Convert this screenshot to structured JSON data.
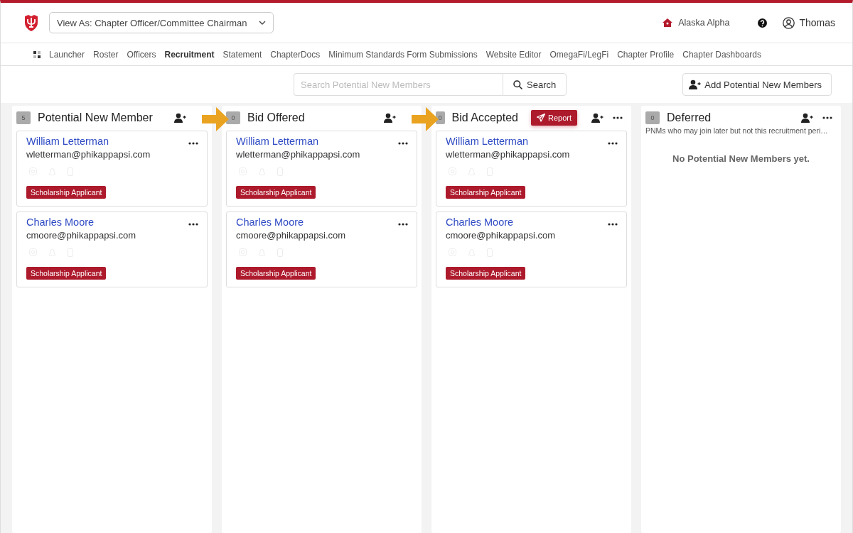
{
  "header": {
    "view_as": "View As: Chapter Officer/Committee Chairman",
    "chapter": "Alaska Alpha",
    "user": "Thomas"
  },
  "nav": [
    {
      "label": "Launcher",
      "selected": false
    },
    {
      "label": "Roster",
      "selected": false
    },
    {
      "label": "Officers",
      "selected": false
    },
    {
      "label": "Recruitment",
      "selected": true
    },
    {
      "label": "Statement",
      "selected": false
    },
    {
      "label": "ChapterDocs",
      "selected": false
    },
    {
      "label": "Minimum Standards Form Submissions",
      "selected": false
    },
    {
      "label": "Website Editor",
      "selected": false
    },
    {
      "label": "OmegaFi/LegFi",
      "selected": false
    },
    {
      "label": "Chapter Profile",
      "selected": false
    },
    {
      "label": "Chapter Dashboards",
      "selected": false
    }
  ],
  "search": {
    "placeholder": "Search Potential New Members",
    "button": "Search"
  },
  "add_button": "Add Potential New Members",
  "columns": [
    {
      "count": "5",
      "title": "Potential New Member",
      "more_menu": false,
      "arrow_after": true,
      "cards": [
        {
          "name": "William Letterman",
          "email": "wletterman@phikappapsi.com",
          "tags": [
            "Scholarship Applicant"
          ]
        },
        {
          "name": "Charles Moore",
          "email": "cmoore@phikappapsi.com",
          "tags": [
            "Scholarship Applicant"
          ]
        }
      ]
    },
    {
      "count": "0",
      "title": "Bid Offered",
      "more_menu": false,
      "arrow_after": true,
      "cards": [
        {
          "name": "William Letterman",
          "email": "wletterman@phikappapsi.com",
          "tags": [
            "Scholarship Applicant"
          ]
        },
        {
          "name": "Charles Moore",
          "email": "cmoore@phikappapsi.com",
          "tags": [
            "Scholarship Applicant"
          ]
        }
      ]
    },
    {
      "count": "0",
      "title": "Bid Accepted",
      "report_button": "Report",
      "more_menu": true,
      "arrow_after": false,
      "cards": [
        {
          "name": "William Letterman",
          "email": "wletterman@phikappapsi.com",
          "tags": [
            "Scholarship Applicant"
          ]
        },
        {
          "name": "Charles Moore",
          "email": "cmoore@phikappapsi.com",
          "tags": [
            "Scholarship Applicant"
          ]
        }
      ]
    },
    {
      "count": "0",
      "title": "Deferred",
      "description": "PNMs who may join later but not this recruitment peri…",
      "more_menu": true,
      "arrow_after": false,
      "empty_message": "No Potential New Members yet."
    }
  ]
}
